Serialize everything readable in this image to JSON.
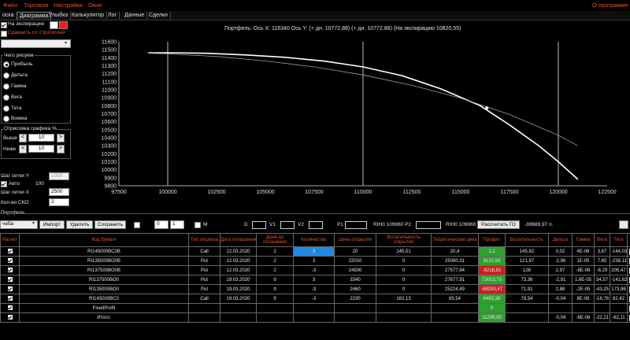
{
  "menu": {
    "file": "Файл",
    "trade": "Торговля",
    "settings": "Настройки",
    "window": "Окно",
    "about": "О программе"
  },
  "tabs": [
    "оска",
    "Диаграмма",
    "Улыбка",
    "Калькулятор",
    "Лог",
    "Данные",
    "Сделки"
  ],
  "left": {
    "at_expiry": "На экспирацию",
    "compare": "Сравнить со стратегией",
    "what_group": "Чего рисуем",
    "radios": [
      "Прибыль",
      "Дельта",
      "Гамма",
      "Вега",
      "Тета",
      "Вомма"
    ],
    "draw_group": "Отрисовка графика %",
    "above_label": "Выше",
    "above_value": "10",
    "below_label": "Ниже",
    "below_value": "10",
    "grid_y_label": "Шаг сетки Y",
    "grid_y_value": "1000",
    "auto_label": "Авто",
    "auto_value": "100",
    "grid_x_label": "Шаг сетки Х",
    "grid_x_value": "2500",
    "sko_label": "Кол-во СКО",
    "sko_value": "2"
  },
  "chart_header": "Портфель: Ось X: 116340 Ось Y:  (+ дн.  10772,88)  (+ дн.  10772,88)  (На экспирацию 10820,55)",
  "chart_data": {
    "type": "line",
    "title": "",
    "xlabel": "",
    "ylabel": "",
    "xlim": [
      97500,
      122500
    ],
    "ylim": [
      9800,
      11600
    ],
    "xticks": [
      97500,
      100000,
      102500,
      105000,
      107500,
      110000,
      112500,
      115000,
      117500,
      120000,
      122500
    ],
    "yticks": [
      9800,
      9900,
      10000,
      10100,
      10200,
      10300,
      10400,
      10500,
      10600,
      10700,
      10800,
      10900,
      11000,
      11100,
      11200,
      11300,
      11400,
      11500,
      11600
    ],
    "vlines": [
      100000,
      110000,
      120000
    ],
    "marker": {
      "x": 116340,
      "y": 10772.88
    },
    "series": [
      {
        "color": "#ffffff",
        "x": [
          99000,
          100000,
          102000,
          104000,
          106000,
          108000,
          110000,
          112000,
          114000,
          116000,
          117500,
          119000,
          120000,
          121000
        ],
        "y": [
          11460,
          11462,
          11455,
          11435,
          11405,
          11358,
          11285,
          11175,
          11010,
          10800,
          10560,
          10300,
          10100,
          9880
        ]
      },
      {
        "color": "#9a9a9a",
        "x": [
          99000,
          100000,
          102500,
          105000,
          107500,
          110000,
          112500,
          115000,
          117500,
          120000,
          121000
        ],
        "y": [
          11455,
          11450,
          11415,
          11360,
          11285,
          11185,
          11055,
          10895,
          10690,
          10430,
          10300
        ]
      }
    ]
  },
  "portfolio": {
    "label": "Портфель",
    "strategy": "чеба",
    "import": "Импорт",
    "delete": "Удалить",
    "save": "Сохранить",
    "spin1": "0",
    "spin2": "1",
    "m": "M",
    "d": "D",
    "v1": "V1",
    "v2": "V2",
    "p1": "P1",
    "ri1": "RIH0 109960",
    "p2": "P2",
    "ri2": "RIH0 109960",
    "calc_go": "Рассчитать ГО",
    "go_value": "-39689,97 п."
  },
  "table": {
    "headers": [
      "Расчет",
      "Код бумаги",
      "Тип опциона",
      "Дата погашения",
      "Дней до погашения",
      "Количество",
      "Цена открытия",
      "Волатильность открытия",
      "Теоретическая цена",
      "Профит",
      "Волатильность",
      "Дельта",
      "Гамма",
      "Вега",
      "Тета",
      "X"
    ],
    "rows": [
      [
        "RI145000BC0B",
        "Call",
        "12.03.2020",
        "2",
        "3",
        "20",
        "145,51",
        "20,4",
        "1,2",
        "145,82",
        "0,02",
        "4E-06",
        "3,87",
        "-144,03"
      ],
      [
        "RI135000BO0B",
        "Put",
        "12.03.2020",
        "2",
        "3",
        "22010",
        "0",
        "25080,31",
        "9210,93",
        "121,97",
        "-2,96",
        "1E-05",
        "7,65",
        "-238,11"
      ],
      [
        "RI137500BO0B",
        "Put",
        "12.03.2020",
        "2",
        "-3",
        "24500",
        "0",
        "27577,94",
        "-9218,82",
        "128",
        "2,97",
        "-8E-06",
        "-6,29",
        "205,47"
      ],
      [
        "RI137500BO0",
        "Put",
        "19.03.2020",
        "9",
        "3",
        "3340",
        "0",
        "27677,91",
        "73013,73",
        "73,36",
        "-2,91",
        "1,6E-05",
        "34,57",
        "-141,82"
      ],
      [
        "RI135000BO0",
        "Put",
        "19.03.2020",
        "9",
        "-3",
        "2460",
        "0",
        "25224,49",
        "-68293,47",
        "71,91",
        "2,88",
        "-2E-05",
        "-43,25",
        "173,96"
      ],
      [
        "RI145000BC0",
        "Call",
        "19.03.2020",
        "9",
        "-3",
        "2230",
        "162,13",
        "65,54",
        "6493,38",
        "78,54",
        "-0,04",
        "8E-06",
        "-18,76",
        "82,42"
      ],
      [
        "FixedProfit",
        "",
        "",
        "",
        "",
        "",
        "",
        "",
        "0",
        "",
        "",
        "",
        "",
        ""
      ],
      [
        "Итого:",
        "",
        "",
        "",
        "",
        "",
        "",
        "",
        "11206,95",
        "",
        "-0,04",
        "-6E-06",
        "-22,21",
        "-62,11"
      ]
    ],
    "x_label": "X"
  }
}
